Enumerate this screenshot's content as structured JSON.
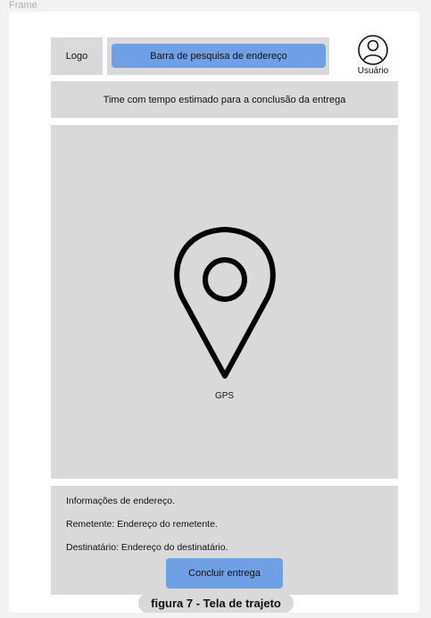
{
  "frame": {
    "label": "Frame"
  },
  "header": {
    "logo_label": "Logo",
    "search_button_label": "Barra de pesquisa de endereço",
    "user_label": "Usuário",
    "user_icon": "user-circle-icon"
  },
  "eta": {
    "text": "Time com tempo estimado para a conclusão da entrega"
  },
  "map": {
    "pin_icon": "location-pin-icon",
    "label": "GPS"
  },
  "info": {
    "title": "Informações de endereço.",
    "sender": "Remetente: Endereço do remetente.",
    "recipient": "Destinatário: Endereço do destinatário.",
    "finish_button_label": "Concluir entrega"
  },
  "caption": "figura 7 - Tela de trajeto",
  "colors": {
    "accent": "#6fa0e6",
    "block": "#d9d9d9",
    "background": "#ffffff"
  }
}
